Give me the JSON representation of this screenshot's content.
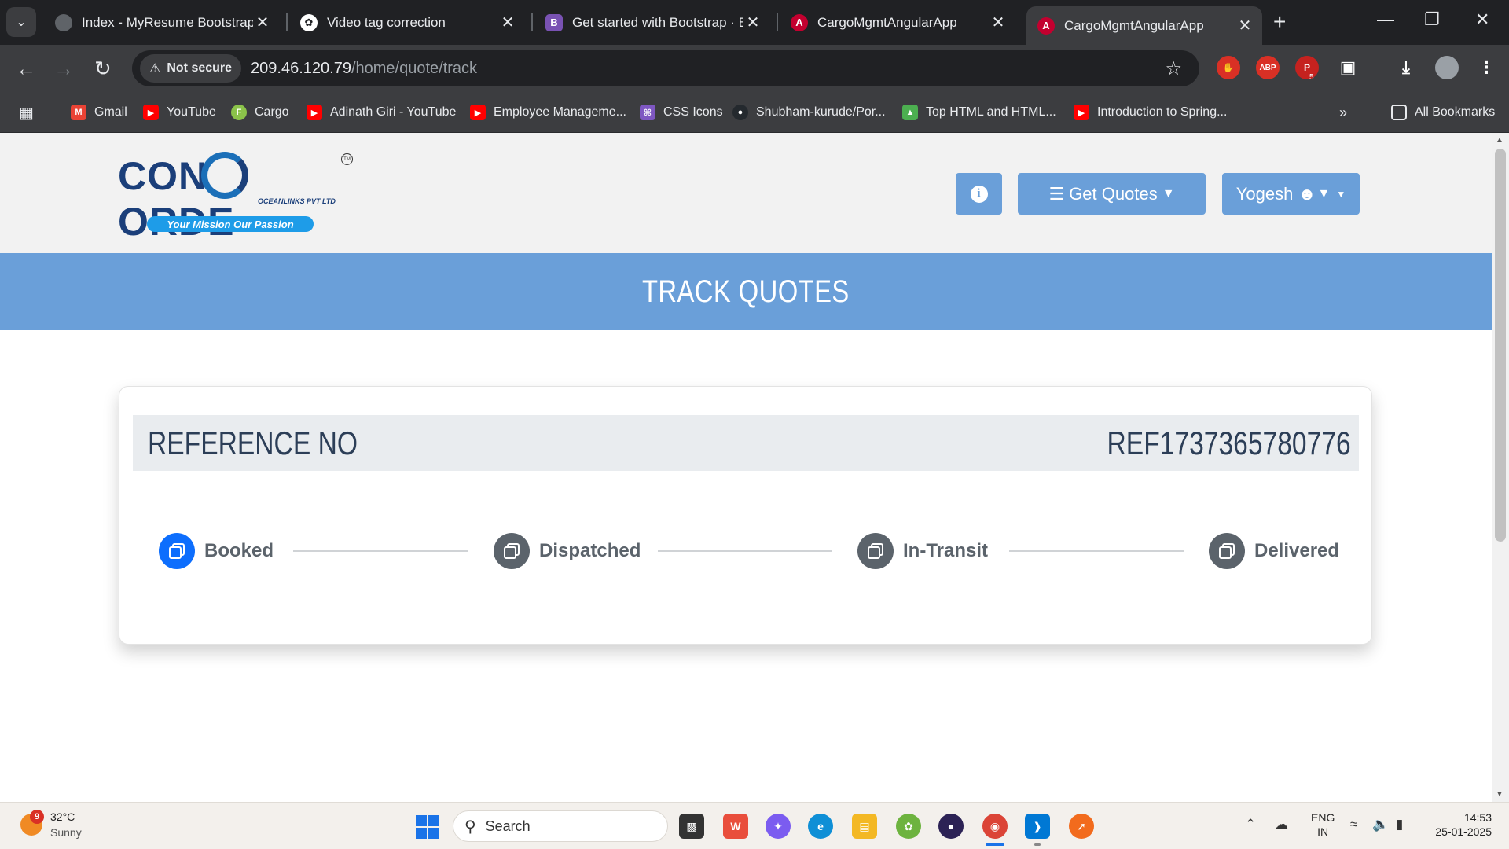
{
  "browser": {
    "tabs": [
      {
        "title": "Index - MyResume Bootstrap Te",
        "icon": "globe-icon",
        "active": false
      },
      {
        "title": "Video tag correction",
        "icon": "chatgpt-icon",
        "active": false
      },
      {
        "title": "Get started with Bootstrap · Boo",
        "icon": "bootstrap-icon",
        "active": false
      },
      {
        "title": "CargoMgmtAngularApp",
        "icon": "angular-icon",
        "active": false
      },
      {
        "title": "CargoMgmtAngularApp",
        "icon": "angular-icon",
        "active": true
      }
    ],
    "security_chip": "Not secure",
    "url_host": "209.46.120.79",
    "url_path": "/home/quote/track",
    "extension_badge": "5",
    "bookmarks": [
      {
        "label": "Gmail",
        "icon": "gmail-icon"
      },
      {
        "label": "YouTube",
        "icon": "youtube-icon"
      },
      {
        "label": "Cargo",
        "icon": "cargo-icon"
      },
      {
        "label": "Adinath Giri - YouTube",
        "icon": "youtube-icon"
      },
      {
        "label": "Employee Manageme...",
        "icon": "youtube-icon"
      },
      {
        "label": "CSS Icons",
        "icon": "css-icons-icon"
      },
      {
        "label": "Shubham-kurude/Por...",
        "icon": "github-icon"
      },
      {
        "label": "Top HTML and HTML...",
        "icon": "mountain-icon"
      },
      {
        "label": "Introduction to Spring...",
        "icon": "youtube-icon"
      }
    ],
    "all_bookmarks": "All Bookmarks",
    "colors": {
      "frame": "#202124",
      "toolbar": "#3c3d40"
    }
  },
  "site": {
    "logo": {
      "word": "CONCORDE",
      "subtitle": "OCEANLINKS PVT LTD",
      "tagline": "Your Mission Our Passion",
      "tm": "TM"
    },
    "header": {
      "info_icon": "info-icon",
      "get_quotes_label": "Get Quotes",
      "user_label": "Yogesh"
    },
    "page_title": "TRACK QUOTES",
    "reference": {
      "label": "REFERENCE NO",
      "value": "REF1737365780776"
    },
    "steps": [
      {
        "label": "Booked",
        "status": "active"
      },
      {
        "label": "Dispatched",
        "status": "pending"
      },
      {
        "label": "In-Transit",
        "status": "pending"
      },
      {
        "label": "Delivered",
        "status": "pending"
      }
    ],
    "colors": {
      "accent": "#6a9fd9",
      "step_active": "#0d6efd",
      "step_pending": "#5b636b",
      "header_bg": "#f2f2f2"
    }
  },
  "taskbar": {
    "weather": {
      "temp": "32°C",
      "condition": "Sunny",
      "badge": "9"
    },
    "search_placeholder": "Search",
    "language": {
      "line1": "ENG",
      "line2": "IN"
    },
    "clock": {
      "time": "14:53",
      "date": "25-01-2025"
    }
  }
}
